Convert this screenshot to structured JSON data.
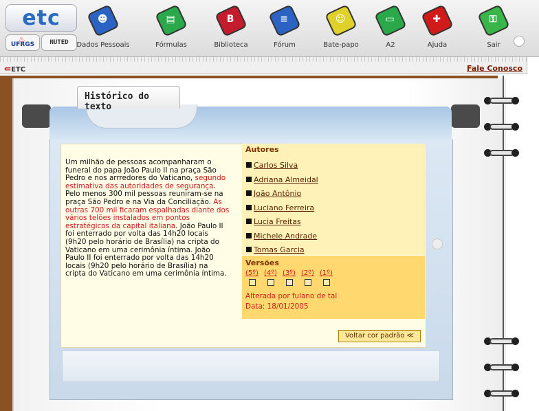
{
  "brand": {
    "logo": "etc",
    "partner_1": "UFRGS",
    "partner_2": "NUTED"
  },
  "nav": [
    {
      "label": "Dados Pessoais",
      "icon": "personal-data-icon",
      "color": "#2b63c4",
      "glyph": "☻"
    },
    {
      "label": "Fórmulas",
      "icon": "formulas-icon",
      "color": "#2aa84a",
      "glyph": "▤"
    },
    {
      "label": "Biblioteca",
      "icon": "library-icon",
      "color": "#c41c2c",
      "glyph": "B"
    },
    {
      "label": "Fórum",
      "icon": "forum-icon",
      "color": "#2b63c4",
      "glyph": "≡"
    },
    {
      "label": "Bate-papo",
      "icon": "chat-icon",
      "color": "#e0d12a",
      "glyph": "☺"
    },
    {
      "label": "A2",
      "icon": "a2-icon",
      "color": "#2aa84a",
      "glyph": "▭"
    },
    {
      "label": "Ajuda",
      "icon": "help-icon",
      "color": "#d11a1a",
      "glyph": "✚"
    },
    {
      "label": "Sair",
      "icon": "exit-icon",
      "color": "#39b54a",
      "glyph": "⚿"
    }
  ],
  "subbar": {
    "back_label": "ETC",
    "contact_label": "Fale Conosco"
  },
  "folder": {
    "tab_title": "Histórico do texto"
  },
  "body": {
    "p1": "Um milhão de pessoas acompanharam o funeral do papa João Paulo II na praça São Pedro e nos arrredores do Vaticano, ",
    "p1_red": "segundo estimativa das autoridades de segurança",
    "p2": ". Pelo menos 300 mil pessoas reuniram-se na praça São Pedro e na Via da Conciliação. ",
    "p2_red": "As outras 700 mil ficaram espalhadas diante dos vários telões instalados em pontos estratégicos da capital italiana",
    "p3": ". João Paulo II foi enterrado por volta das 14h20 locais (9h20 pelo horário de Brasília) na cripta do Vaticano em uma cerimônia íntima. João Paulo II foi enterrado por volta das 14h20 locais (9h20 pelo horário de Brasília) na cripta do Vaticano em uma cerimônia íntima."
  },
  "authors": {
    "title": "Autores",
    "items": [
      "Carlos Silva",
      "Adriana Almeidal",
      "João Antônio",
      "Luciano Ferreira",
      "Lucia Freitas",
      "Michele Andrade",
      "Tomas Garcia"
    ]
  },
  "versions": {
    "title": "Versões",
    "items": [
      "(5º)",
      "(4º)",
      "(3º)",
      "(2º)",
      "(1º)"
    ],
    "changed_by": "Alterada por fulano de tal",
    "date": "Data: 18/01/2005"
  },
  "reset_button": "Voltar cor padrão ≪"
}
